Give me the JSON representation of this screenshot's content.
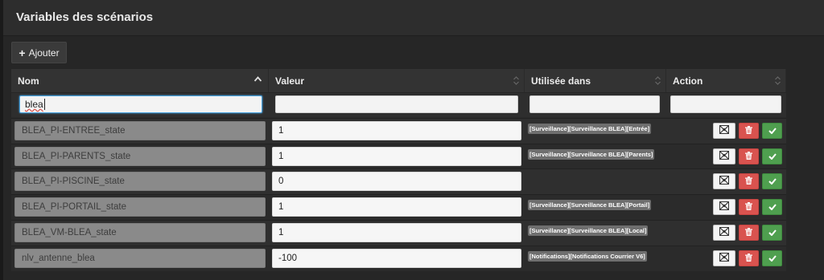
{
  "page": {
    "title": "Variables des scénarios"
  },
  "toolbar": {
    "add_label": "Ajouter"
  },
  "table": {
    "columns": [
      {
        "label": "Nom",
        "sort": "ascending"
      },
      {
        "label": "Valeur",
        "sort": "none"
      },
      {
        "label": "Utilisée dans",
        "sort": "none"
      },
      {
        "label": "Action",
        "sort": "none"
      }
    ],
    "filters": {
      "nom": "blea",
      "valeur": "",
      "utilisee": "",
      "action": ""
    },
    "rows": [
      {
        "name": "BLEA_PI-ENTREE_state",
        "value": "1",
        "usage": "[Surveillance][Surveillance BLEA][Entrée]"
      },
      {
        "name": "BLEA_PI-PARENTS_state",
        "value": "1",
        "usage": "[Surveillance][Surveillance BLEA][Parents]"
      },
      {
        "name": "BLEA_PI-PISCINE_state",
        "value": "0",
        "usage": ""
      },
      {
        "name": "BLEA_PI-PORTAIL_state",
        "value": "1",
        "usage": "[Surveillance][Surveillance BLEA][Portail]"
      },
      {
        "name": "BLEA_VM-BLEA_state",
        "value": "1",
        "usage": "[Surveillance][Surveillance BLEA][Local]"
      },
      {
        "name": "nlv_antenne_blea",
        "value": "-100",
        "usage": "[Notifications][Notifications Courrier V6]"
      }
    ]
  },
  "icons": {
    "add": "plus-icon",
    "sort": "sort-icon",
    "config": "configure-icon",
    "remove": "trash-icon",
    "save": "check-icon"
  },
  "colors": {
    "remove_button": "#d9534f",
    "save_button": "#4f9f4f",
    "usage_tag": "#6e6e6e",
    "focus_border": "#4aa3df"
  }
}
